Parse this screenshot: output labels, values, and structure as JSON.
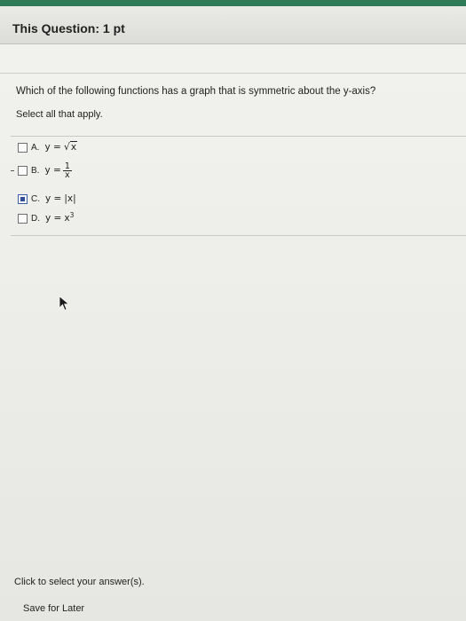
{
  "header": {
    "title": "This Question: 1 pt"
  },
  "question": {
    "text": "Which of the following functions has a graph that is symmetric about the y-axis?",
    "instruction": "Select all that apply."
  },
  "options": [
    {
      "letter": "A.",
      "lhs": "y =",
      "checked": false
    },
    {
      "letter": "B.",
      "lhs": "y =",
      "numerator": "1",
      "denominator": "x",
      "checked": false
    },
    {
      "letter": "C.",
      "lhs": "y =",
      "rhs": "|x|",
      "checked": true
    },
    {
      "letter": "D.",
      "lhs": "y =",
      "base": "x",
      "exponent": "3",
      "checked": false
    }
  ],
  "option_a_radicand": "x",
  "footer": {
    "status": "Click to select your answer(s).",
    "save_later": "Save for Later"
  },
  "colors": {
    "accent_strip": "#2f7a57",
    "checkbox_fill": "#2f4f9a"
  }
}
